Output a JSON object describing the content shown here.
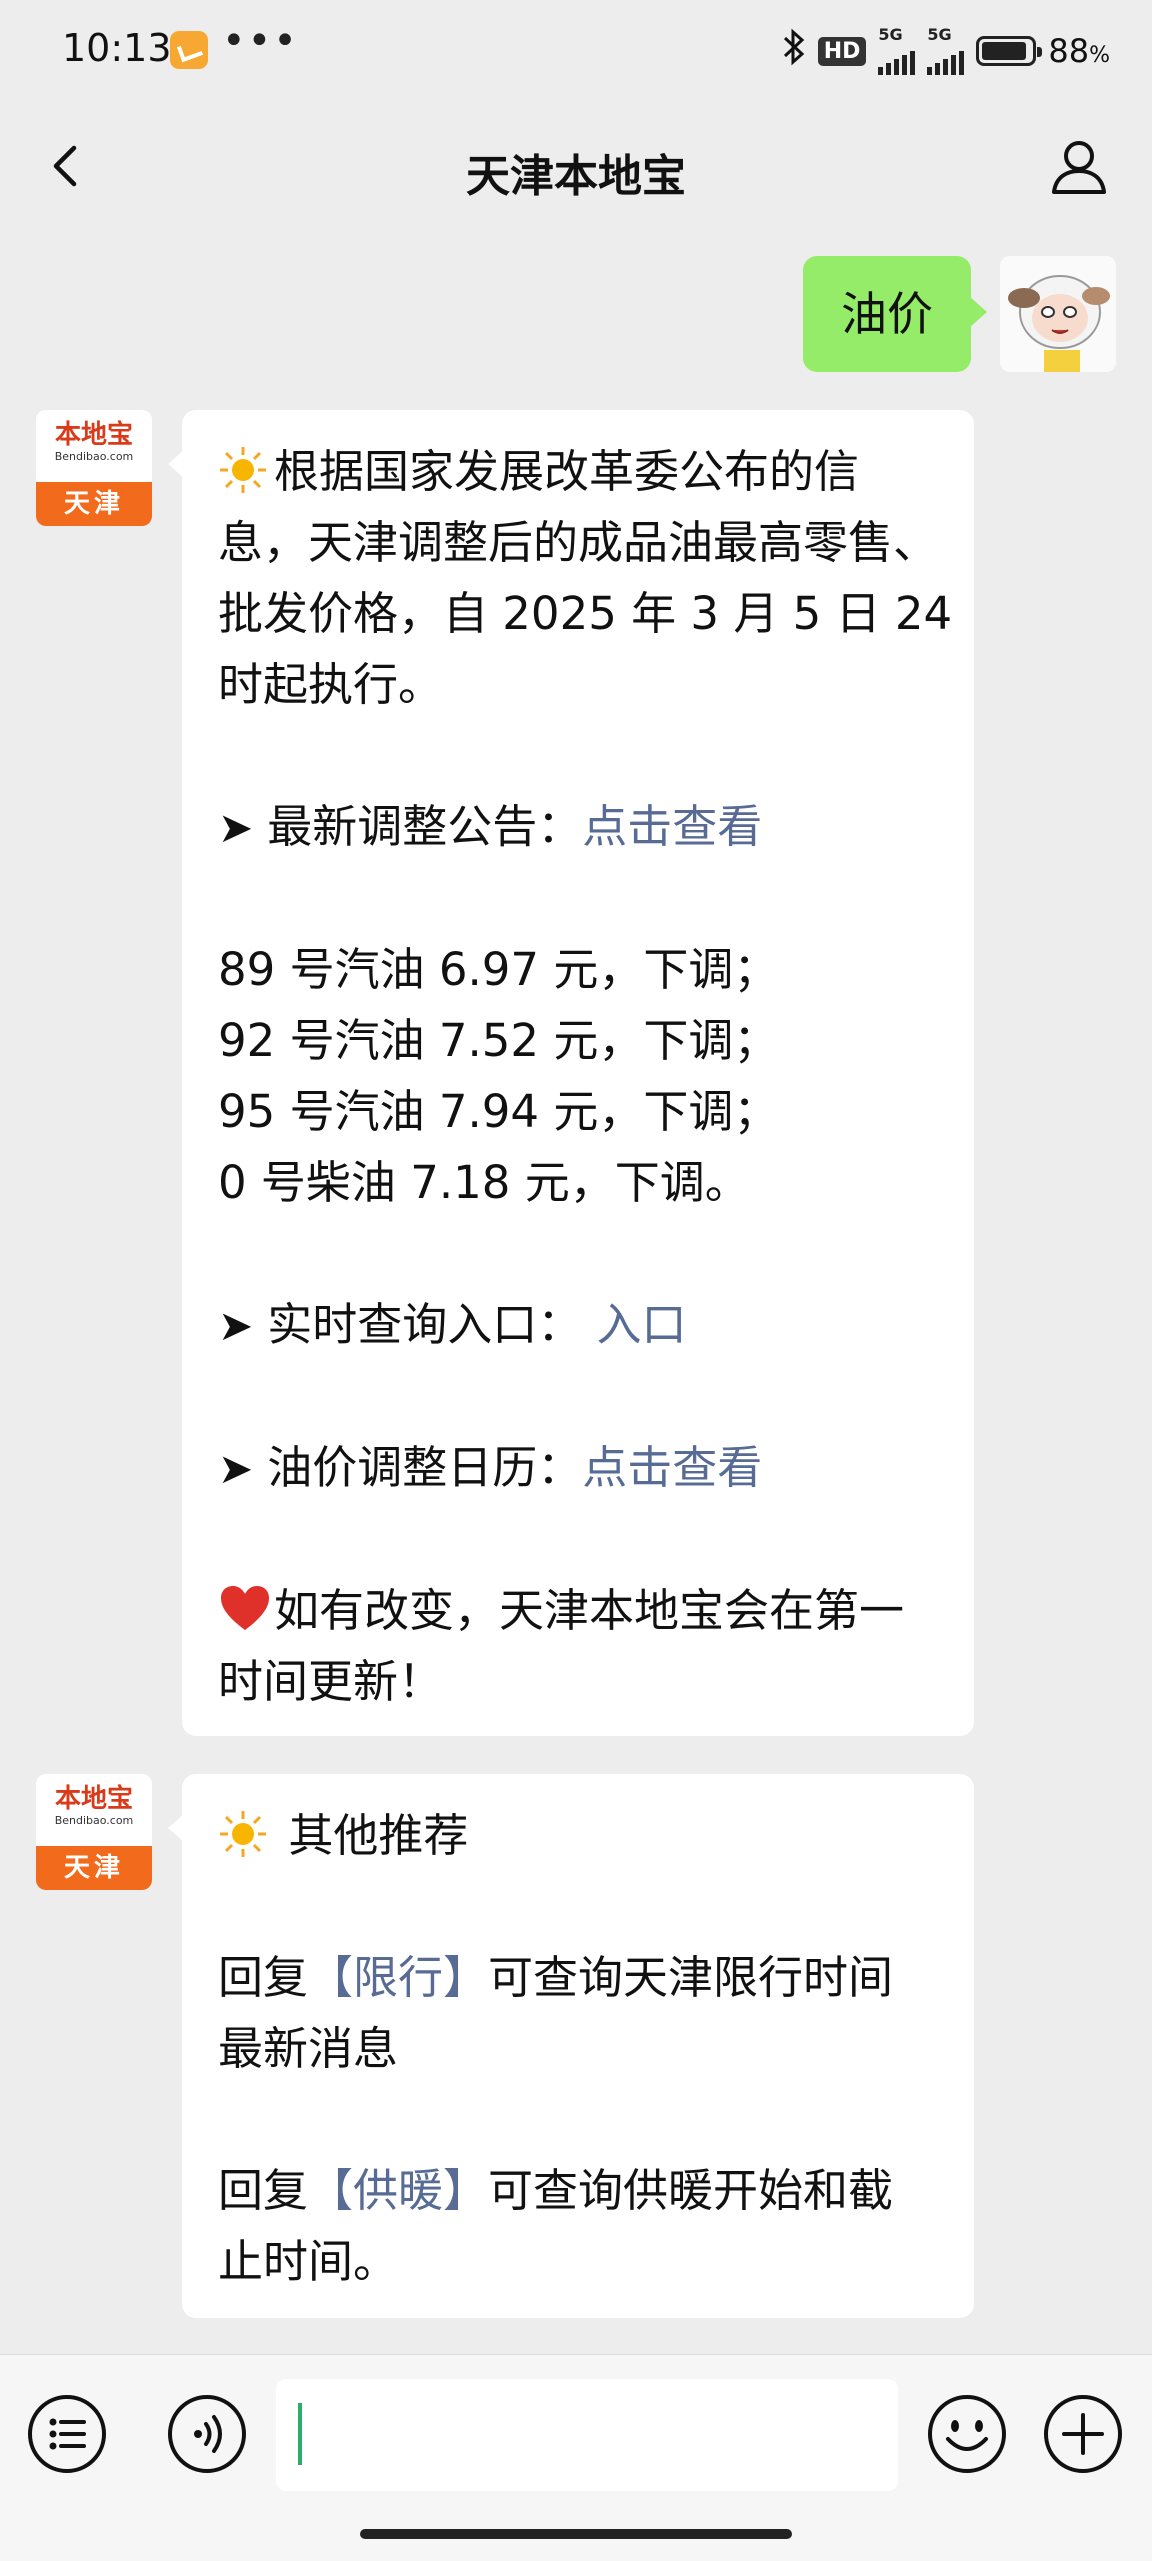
{
  "status_bar": {
    "time": "10:13",
    "dots": "•••",
    "network_badge": "HD",
    "signal1_label": "5G",
    "signal2_label": "5G",
    "battery_percent": "88",
    "battery_unit": "%"
  },
  "nav": {
    "title": "天津本地宝"
  },
  "sent_message": {
    "text": "油价"
  },
  "bot_avatar": {
    "brand": "本地宝",
    "domain": "Bendibao.com",
    "city": "天津"
  },
  "message1": {
    "intro_lines": [
      "根据国家发展改革委公布的信",
      "息，天津调整后的成品油最高零售、",
      "批发价格，自 2025 年 3 月 5 日 24",
      "时起执行。"
    ],
    "notice_label": "最新调整公告：",
    "notice_link": "点击查看",
    "prices": [
      "89 号汽油 6.97 元，下调；",
      "92 号汽油 7.52 元，下调；",
      "95 号汽油 7.94 元，下调；",
      "0 号柴油 7.18 元，下调。"
    ],
    "query_label": "实时查询入口：",
    "query_link": "入口",
    "calendar_label": "油价调整日历：",
    "calendar_link": "点击查看",
    "footer_lines": [
      "如有改变，天津本地宝会在第一",
      "时间更新！"
    ]
  },
  "message2": {
    "title": "其他推荐",
    "item1_prefix": "回复",
    "item1_link": "【限行】",
    "item1_suffix": "可查询天津限行时间",
    "item1_line2": "最新消息",
    "item2_prefix": "回复",
    "item2_link": "【供暖】",
    "item2_suffix": "可查询供暖开始和截",
    "item2_line2": "止时间。"
  },
  "icons": {
    "back": "chevron-left-icon",
    "user": "person-icon",
    "menu": "list-menu-icon",
    "voice": "voice-icon",
    "emoji": "emoji-icon",
    "plus": "plus-icon"
  },
  "colors": {
    "sent_bubble": "#95ec69",
    "link": "#576b95",
    "brand_orange": "#f26a1b"
  }
}
